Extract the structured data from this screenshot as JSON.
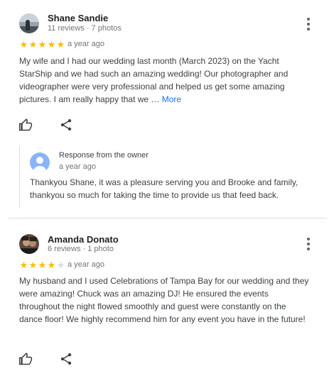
{
  "reviews": [
    {
      "name": "Shane Sandie",
      "meta": "11 reviews · 7 photos",
      "rating": 5,
      "time": "a year ago",
      "text": "My wife and I had our wedding last month (March 2023) on the Yacht StarShip and we had such an amazing wedding! Our photographer and videographer were very professional and helped us get some amazing pictures. I am really happy that we …",
      "more_label": "More",
      "owner_response": {
        "title": "Response from the owner",
        "time": "a year ago",
        "text": "Thankyou Shane, it was a pleasure serving you and Brooke and family, thankyou so much for taking the time to provide us that feed back."
      }
    },
    {
      "name": "Amanda Donato",
      "meta": "6 reviews · 1 photo",
      "rating": 4,
      "time": "a year ago",
      "text": "My husband and I used Celebrations of Tampa Bay for our wedding and they were amazing! Chuck was an amazing DJ! He ensured the events throughout the night flowed smoothly and guest were constantly on the dance floor! We highly recommend him for any event you have in the future!"
    }
  ],
  "colors": {
    "star_on": "#fbbc04",
    "star_off": "#dadce0",
    "link": "#1a73e8",
    "owner_avatar": "#8ab4f8"
  },
  "icons": {
    "like": "thumbs-up-icon",
    "share": "share-icon",
    "menu": "more-vert-icon"
  }
}
